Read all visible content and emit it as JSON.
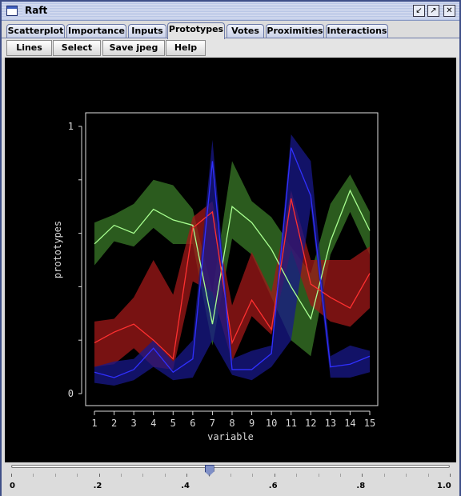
{
  "window": {
    "title": "Raft",
    "controls": [
      "minimize-icon",
      "maximize-icon",
      "close-icon"
    ]
  },
  "tabs": [
    {
      "label": "Scatterplot",
      "active": false
    },
    {
      "label": "Importance",
      "active": false
    },
    {
      "label": "Inputs",
      "active": false
    },
    {
      "label": "Prototypes",
      "active": true
    },
    {
      "label": "Votes",
      "active": false
    },
    {
      "label": "Proximities",
      "active": false
    },
    {
      "label": "Interactions",
      "active": false
    }
  ],
  "toolbar": {
    "lines": "Lines",
    "select": "Select",
    "save_jpeg": "Save jpeg",
    "help": "Help"
  },
  "slider": {
    "value": 0.45,
    "labels": [
      "0",
      ".2",
      ".4",
      ".6",
      ".8",
      "1.0"
    ]
  },
  "colors": {
    "green": "#3a7a28",
    "green_line": "#a8ff90",
    "red": "#a01818",
    "red_line": "#ff3030",
    "blue": "#18188a",
    "blue_line": "#3030ff"
  },
  "chart_data": {
    "type": "line",
    "xlabel": "variable",
    "ylabel": "prototypes",
    "x": [
      1,
      2,
      3,
      4,
      5,
      6,
      7,
      8,
      9,
      10,
      11,
      12,
      13,
      14,
      15
    ],
    "ylim": [
      0,
      1
    ],
    "ytick_labels": [
      "0",
      "1"
    ],
    "series": [
      {
        "color": "green",
        "values": [
          0.56,
          0.63,
          0.6,
          0.69,
          0.65,
          0.63,
          0.26,
          0.7,
          0.64,
          0.54,
          0.4,
          0.28,
          0.57,
          0.76,
          0.61
        ],
        "upper": [
          0.64,
          0.67,
          0.71,
          0.8,
          0.78,
          0.69,
          0.38,
          0.87,
          0.72,
          0.66,
          0.55,
          0.45,
          0.71,
          0.82,
          0.68
        ],
        "lower": [
          0.48,
          0.57,
          0.55,
          0.62,
          0.56,
          0.56,
          0.18,
          0.58,
          0.52,
          0.36,
          0.2,
          0.14,
          0.52,
          0.68,
          0.52
        ]
      },
      {
        "color": "red",
        "values": [
          0.19,
          0.23,
          0.26,
          0.2,
          0.13,
          0.62,
          0.68,
          0.19,
          0.35,
          0.24,
          0.73,
          0.41,
          0.36,
          0.32,
          0.45
        ],
        "upper": [
          0.27,
          0.28,
          0.36,
          0.5,
          0.37,
          0.66,
          0.72,
          0.33,
          0.53,
          0.38,
          0.76,
          0.5,
          0.5,
          0.5,
          0.55
        ],
        "lower": [
          0.1,
          0.11,
          0.17,
          0.1,
          0.09,
          0.42,
          0.38,
          0.12,
          0.29,
          0.22,
          0.54,
          0.33,
          0.27,
          0.25,
          0.32
        ]
      },
      {
        "color": "blue",
        "values": [
          0.08,
          0.06,
          0.09,
          0.17,
          0.08,
          0.13,
          0.87,
          0.09,
          0.09,
          0.15,
          0.92,
          0.74,
          0.1,
          0.11,
          0.14
        ],
        "upper": [
          0.1,
          0.12,
          0.13,
          0.2,
          0.12,
          0.2,
          0.95,
          0.13,
          0.16,
          0.18,
          0.97,
          0.87,
          0.14,
          0.18,
          0.16
        ],
        "lower": [
          0.04,
          0.03,
          0.05,
          0.1,
          0.05,
          0.06,
          0.2,
          0.07,
          0.05,
          0.1,
          0.2,
          0.7,
          0.06,
          0.06,
          0.08
        ]
      }
    ]
  }
}
